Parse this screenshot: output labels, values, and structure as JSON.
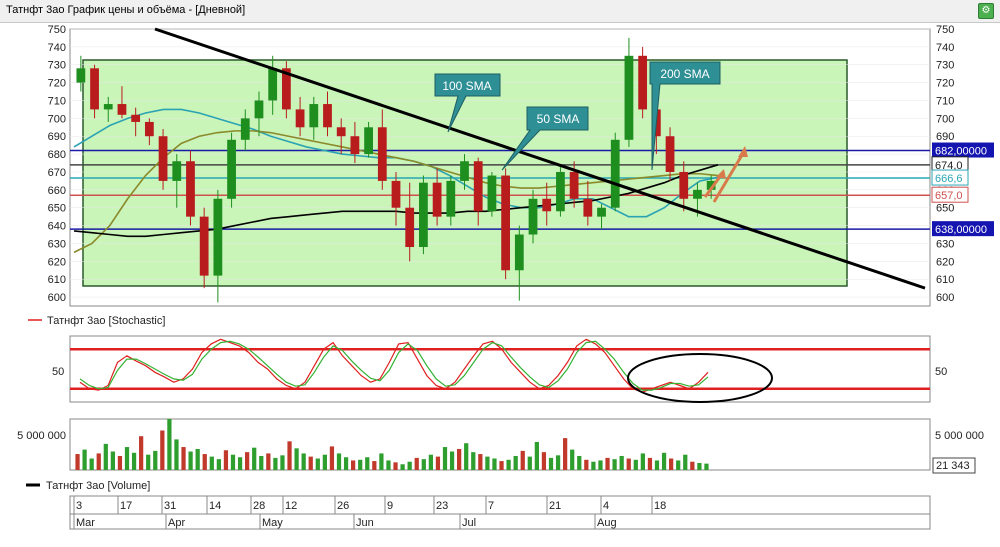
{
  "window": {
    "title": "Татнфт 3ао График цены и объёма - [Дневной]"
  },
  "chart_data": [
    {
      "type": "candlestick",
      "ylim": [
        595,
        750
      ],
      "ytick_step": 10,
      "yticks_left": [
        600,
        610,
        620,
        630,
        640,
        650,
        660,
        670,
        680,
        690,
        700,
        710,
        720,
        730,
        740,
        750
      ],
      "yticks_right": [
        600,
        610,
        620,
        630,
        640,
        650,
        660,
        670,
        680,
        690,
        700,
        710,
        720,
        730,
        740,
        750
      ],
      "price_labels": [
        {
          "label": "682,00000",
          "value": 682,
          "color": "#1a1aa6"
        },
        {
          "label": "674,0",
          "value": 674,
          "color": "#222222"
        },
        {
          "label": "666,6",
          "value": 666.6,
          "color": "#2aa7b6"
        },
        {
          "label": "657,0",
          "value": 657,
          "color": "#d05050"
        },
        {
          "label": "638,00000",
          "value": 638,
          "color": "#1a1aa6"
        }
      ],
      "horizontal_lines": [
        {
          "value": 682,
          "color": "#1a1aa6"
        },
        {
          "value": 674,
          "color": "#444444"
        },
        {
          "value": 666.6,
          "color": "#2aa7b6"
        },
        {
          "value": 657,
          "color": "#d05050"
        },
        {
          "value": 638,
          "color": "#1a1aa6"
        }
      ],
      "annotations": [
        {
          "text": "100 SMA",
          "color": "#2e8f95"
        },
        {
          "text": "50 SMA",
          "color": "#2e8f95"
        },
        {
          "text": "200 SMA",
          "color": "#2e8f95"
        }
      ],
      "trendline": {
        "color": "#000000",
        "from_value": 750,
        "to_value": 605
      },
      "series": [
        {
          "name": "50 SMA",
          "color": "#2ba3b3",
          "values": [
            684,
            690,
            696,
            700,
            703,
            705,
            705,
            703,
            700,
            697,
            694,
            690,
            687,
            684,
            682,
            680,
            679,
            678,
            678,
            676,
            673,
            668,
            662,
            656,
            652,
            650,
            650,
            652,
            655,
            655,
            650,
            645,
            645,
            650,
            658,
            665,
            667
          ]
        },
        {
          "name": "100 SMA",
          "color": "#8a8a2a",
          "values": [
            625,
            630,
            640,
            655,
            668,
            678,
            686,
            690,
            692,
            693,
            693,
            692,
            690,
            688,
            686,
            684,
            682,
            680,
            678,
            676,
            673,
            670,
            667,
            664,
            662,
            661,
            661,
            662,
            663,
            664,
            665,
            666,
            667,
            668,
            669,
            669,
            668
          ]
        },
        {
          "name": "200 SMA",
          "color": "#000000",
          "values": [
            637,
            636,
            635,
            634,
            634,
            635,
            636,
            637,
            638,
            640,
            642,
            644,
            645,
            646,
            647,
            648,
            648,
            648,
            648,
            647,
            647,
            647,
            648,
            648,
            649,
            650,
            651,
            652,
            653,
            654,
            656,
            658,
            661,
            664,
            668,
            671,
            674
          ]
        }
      ],
      "candles": [
        [
          720,
          735,
          715,
          728
        ],
        [
          728,
          730,
          700,
          705
        ],
        [
          705,
          712,
          698,
          708
        ],
        [
          708,
          718,
          700,
          702
        ],
        [
          702,
          706,
          690,
          698
        ],
        [
          698,
          700,
          685,
          690
        ],
        [
          690,
          694,
          660,
          665
        ],
        [
          665,
          680,
          650,
          676
        ],
        [
          676,
          682,
          640,
          645
        ],
        [
          645,
          650,
          605,
          612
        ],
        [
          612,
          660,
          597,
          655
        ],
        [
          655,
          692,
          650,
          688
        ],
        [
          688,
          705,
          682,
          700
        ],
        [
          700,
          715,
          690,
          710
        ],
        [
          710,
          735,
          702,
          728
        ],
        [
          728,
          732,
          700,
          705
        ],
        [
          705,
          712,
          690,
          695
        ],
        [
          695,
          712,
          688,
          708
        ],
        [
          708,
          715,
          690,
          695
        ],
        [
          695,
          700,
          680,
          690
        ],
        [
          690,
          698,
          675,
          680
        ],
        [
          680,
          698,
          678,
          695
        ],
        [
          695,
          705,
          660,
          665
        ],
        [
          665,
          670,
          640,
          650
        ],
        [
          650,
          664,
          620,
          628
        ],
        [
          628,
          668,
          624,
          664
        ],
        [
          664,
          672,
          640,
          645
        ],
        [
          645,
          668,
          640,
          665
        ],
        [
          665,
          680,
          660,
          676
        ],
        [
          676,
          678,
          640,
          648
        ],
        [
          648,
          670,
          645,
          668
        ],
        [
          668,
          672,
          610,
          615
        ],
        [
          615,
          640,
          598,
          635
        ],
        [
          635,
          660,
          630,
          655
        ],
        [
          655,
          664,
          640,
          648
        ],
        [
          648,
          674,
          645,
          670
        ],
        [
          670,
          676,
          650,
          655
        ],
        [
          655,
          665,
          640,
          645
        ],
        [
          645,
          652,
          638,
          650
        ],
        [
          650,
          692,
          648,
          688
        ],
        [
          688,
          745,
          684,
          735
        ],
        [
          735,
          740,
          700,
          705
        ],
        [
          705,
          712,
          680,
          690
        ],
        [
          690,
          695,
          665,
          670
        ],
        [
          670,
          676,
          648,
          655
        ],
        [
          655,
          664,
          645,
          660
        ],
        [
          660,
          668,
          655,
          665
        ]
      ]
    },
    {
      "type": "line",
      "legend": "Татнфт 3ао [Stochastic]",
      "yticks": [
        50
      ],
      "levels": [
        {
          "value": 80,
          "color": "#e02020"
        },
        {
          "value": 20,
          "color": "#e02020"
        }
      ],
      "ylim": [
        0,
        100
      ],
      "series": [
        {
          "name": "%K",
          "color": "#e02020",
          "values": [
            30,
            20,
            18,
            25,
            60,
            70,
            62,
            55,
            45,
            38,
            30,
            35,
            50,
            75,
            88,
            95,
            90,
            85,
            75,
            60,
            50,
            35,
            25,
            20,
            30,
            55,
            80,
            90,
            70,
            55,
            40,
            30,
            35,
            60,
            88,
            90,
            65,
            40,
            25,
            20,
            30,
            50,
            70,
            88,
            92,
            80,
            60,
            45,
            30,
            20,
            25,
            40,
            60,
            85,
            95,
            88,
            75,
            55,
            35,
            20,
            15,
            20,
            25,
            30,
            25,
            20,
            30,
            45
          ]
        },
        {
          "name": "%D",
          "color": "#33b233",
          "values": [
            35,
            25,
            20,
            22,
            48,
            65,
            65,
            58,
            50,
            42,
            35,
            33,
            42,
            65,
            80,
            90,
            92,
            88,
            80,
            68,
            55,
            42,
            30,
            24,
            26,
            45,
            68,
            85,
            78,
            62,
            48,
            36,
            32,
            48,
            75,
            88,
            78,
            55,
            35,
            24,
            26,
            40,
            60,
            80,
            90,
            85,
            68,
            52,
            38,
            26,
            22,
            32,
            50,
            75,
            90,
            92,
            80,
            65,
            45,
            28,
            18,
            18,
            22,
            28,
            28,
            24,
            26,
            38
          ]
        }
      ]
    },
    {
      "type": "bar",
      "legend": "Татнфт 3ао [Volume]",
      "yticks_left": [
        "5 000 000"
      ],
      "yticks_right": [
        "5 000 000"
      ],
      "last_value": "21 343",
      "ylim": [
        0,
        8000000
      ],
      "values": [
        2500000,
        3200000,
        1800000,
        2600000,
        4100000,
        2900000,
        2200000,
        3600000,
        2700000,
        5300000,
        2400000,
        3000000,
        6200000,
        8000000,
        4800000,
        3600000,
        2900000,
        3300000,
        2500000,
        2100000,
        1700000,
        3100000,
        2400000,
        2000000,
        2800000,
        3500000,
        2200000,
        2600000,
        1900000,
        2300000,
        4500000,
        3400000,
        2600000,
        2100000,
        1800000,
        2400000,
        3700000,
        2600000,
        2000000,
        1500000,
        1600000,
        2000000,
        1400000,
        2600000,
        1500000,
        1200000,
        900000,
        1300000,
        1900000,
        1700000,
        2400000,
        2100000,
        3600000,
        2900000,
        3300000,
        4200000,
        2800000,
        2500000,
        2100000,
        1800000,
        1400000,
        1600000,
        2200000,
        3000000,
        2100000,
        4400000,
        2800000,
        1900000,
        2300000,
        5000000,
        3200000,
        2200000,
        1600000,
        1300000,
        1500000,
        1900000,
        1700000,
        2200000,
        1800000,
        1600000,
        2600000,
        1900000,
        1500000,
        2700000,
        1800000,
        1500000,
        2400000,
        1300000,
        1100000,
        1000000
      ],
      "colors": [
        "#2e9e2e",
        "#c0392b"
      ]
    }
  ],
  "date_axis": {
    "days": [
      "3",
      "17",
      "31",
      "14",
      "28",
      "12",
      "26",
      "9",
      "23",
      "7",
      "21",
      "4",
      "18"
    ],
    "months": [
      "Mar",
      "Apr",
      "May",
      "Jun",
      "Jul",
      "Aug"
    ]
  }
}
